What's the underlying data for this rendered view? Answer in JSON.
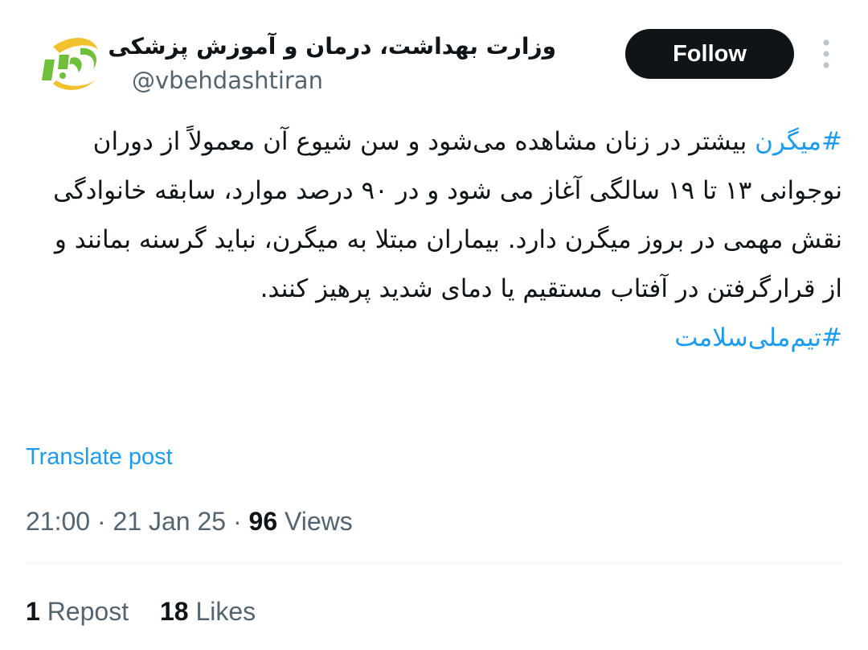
{
  "author": {
    "display_name": "وزارت بهداشت، درمان و آموزش پزشکی",
    "handle": "@vbehdashtiran",
    "avatar_icon": "ministry-logo-icon"
  },
  "follow_button": {
    "label": "Follow"
  },
  "more_button": {
    "icon": "more-vertical-icon"
  },
  "post": {
    "hashtag_1": "#میگرن",
    "text": " بیشتر در زنان مشاهده می‌شود و سن شیوع آن معمولاً از دوران نوجوانی ۱۳ تا ۱۹ سالگی آغاز می شود و در ۹۰ درصد موارد، سابقه خانوادگی نقش مهمی در بروز میگرن دارد. بیماران مبتلا به میگرن، نباید گرسنه بمانند و از قرارگرفتن در آفتاب مستقیم یا دمای شدید پرهیز کنند.",
    "hashtag_2": "#تیم‌ملی‌سلامت"
  },
  "translate_label": "Translate post",
  "meta": {
    "time": "21:00",
    "separator_1": " · ",
    "date": "21 Jan 25",
    "separator_2": " · ",
    "views_count": "96",
    "views_label": " Views"
  },
  "stats": {
    "reposts_count": "1",
    "reposts_label": " Repost",
    "likes_count": "18",
    "likes_label": " Likes"
  },
  "colors": {
    "link": "#1d9bf0",
    "muted": "#536471",
    "text": "#0f1419",
    "logo_green": "#6fbf3a",
    "logo_yellow": "#f2c12e"
  }
}
